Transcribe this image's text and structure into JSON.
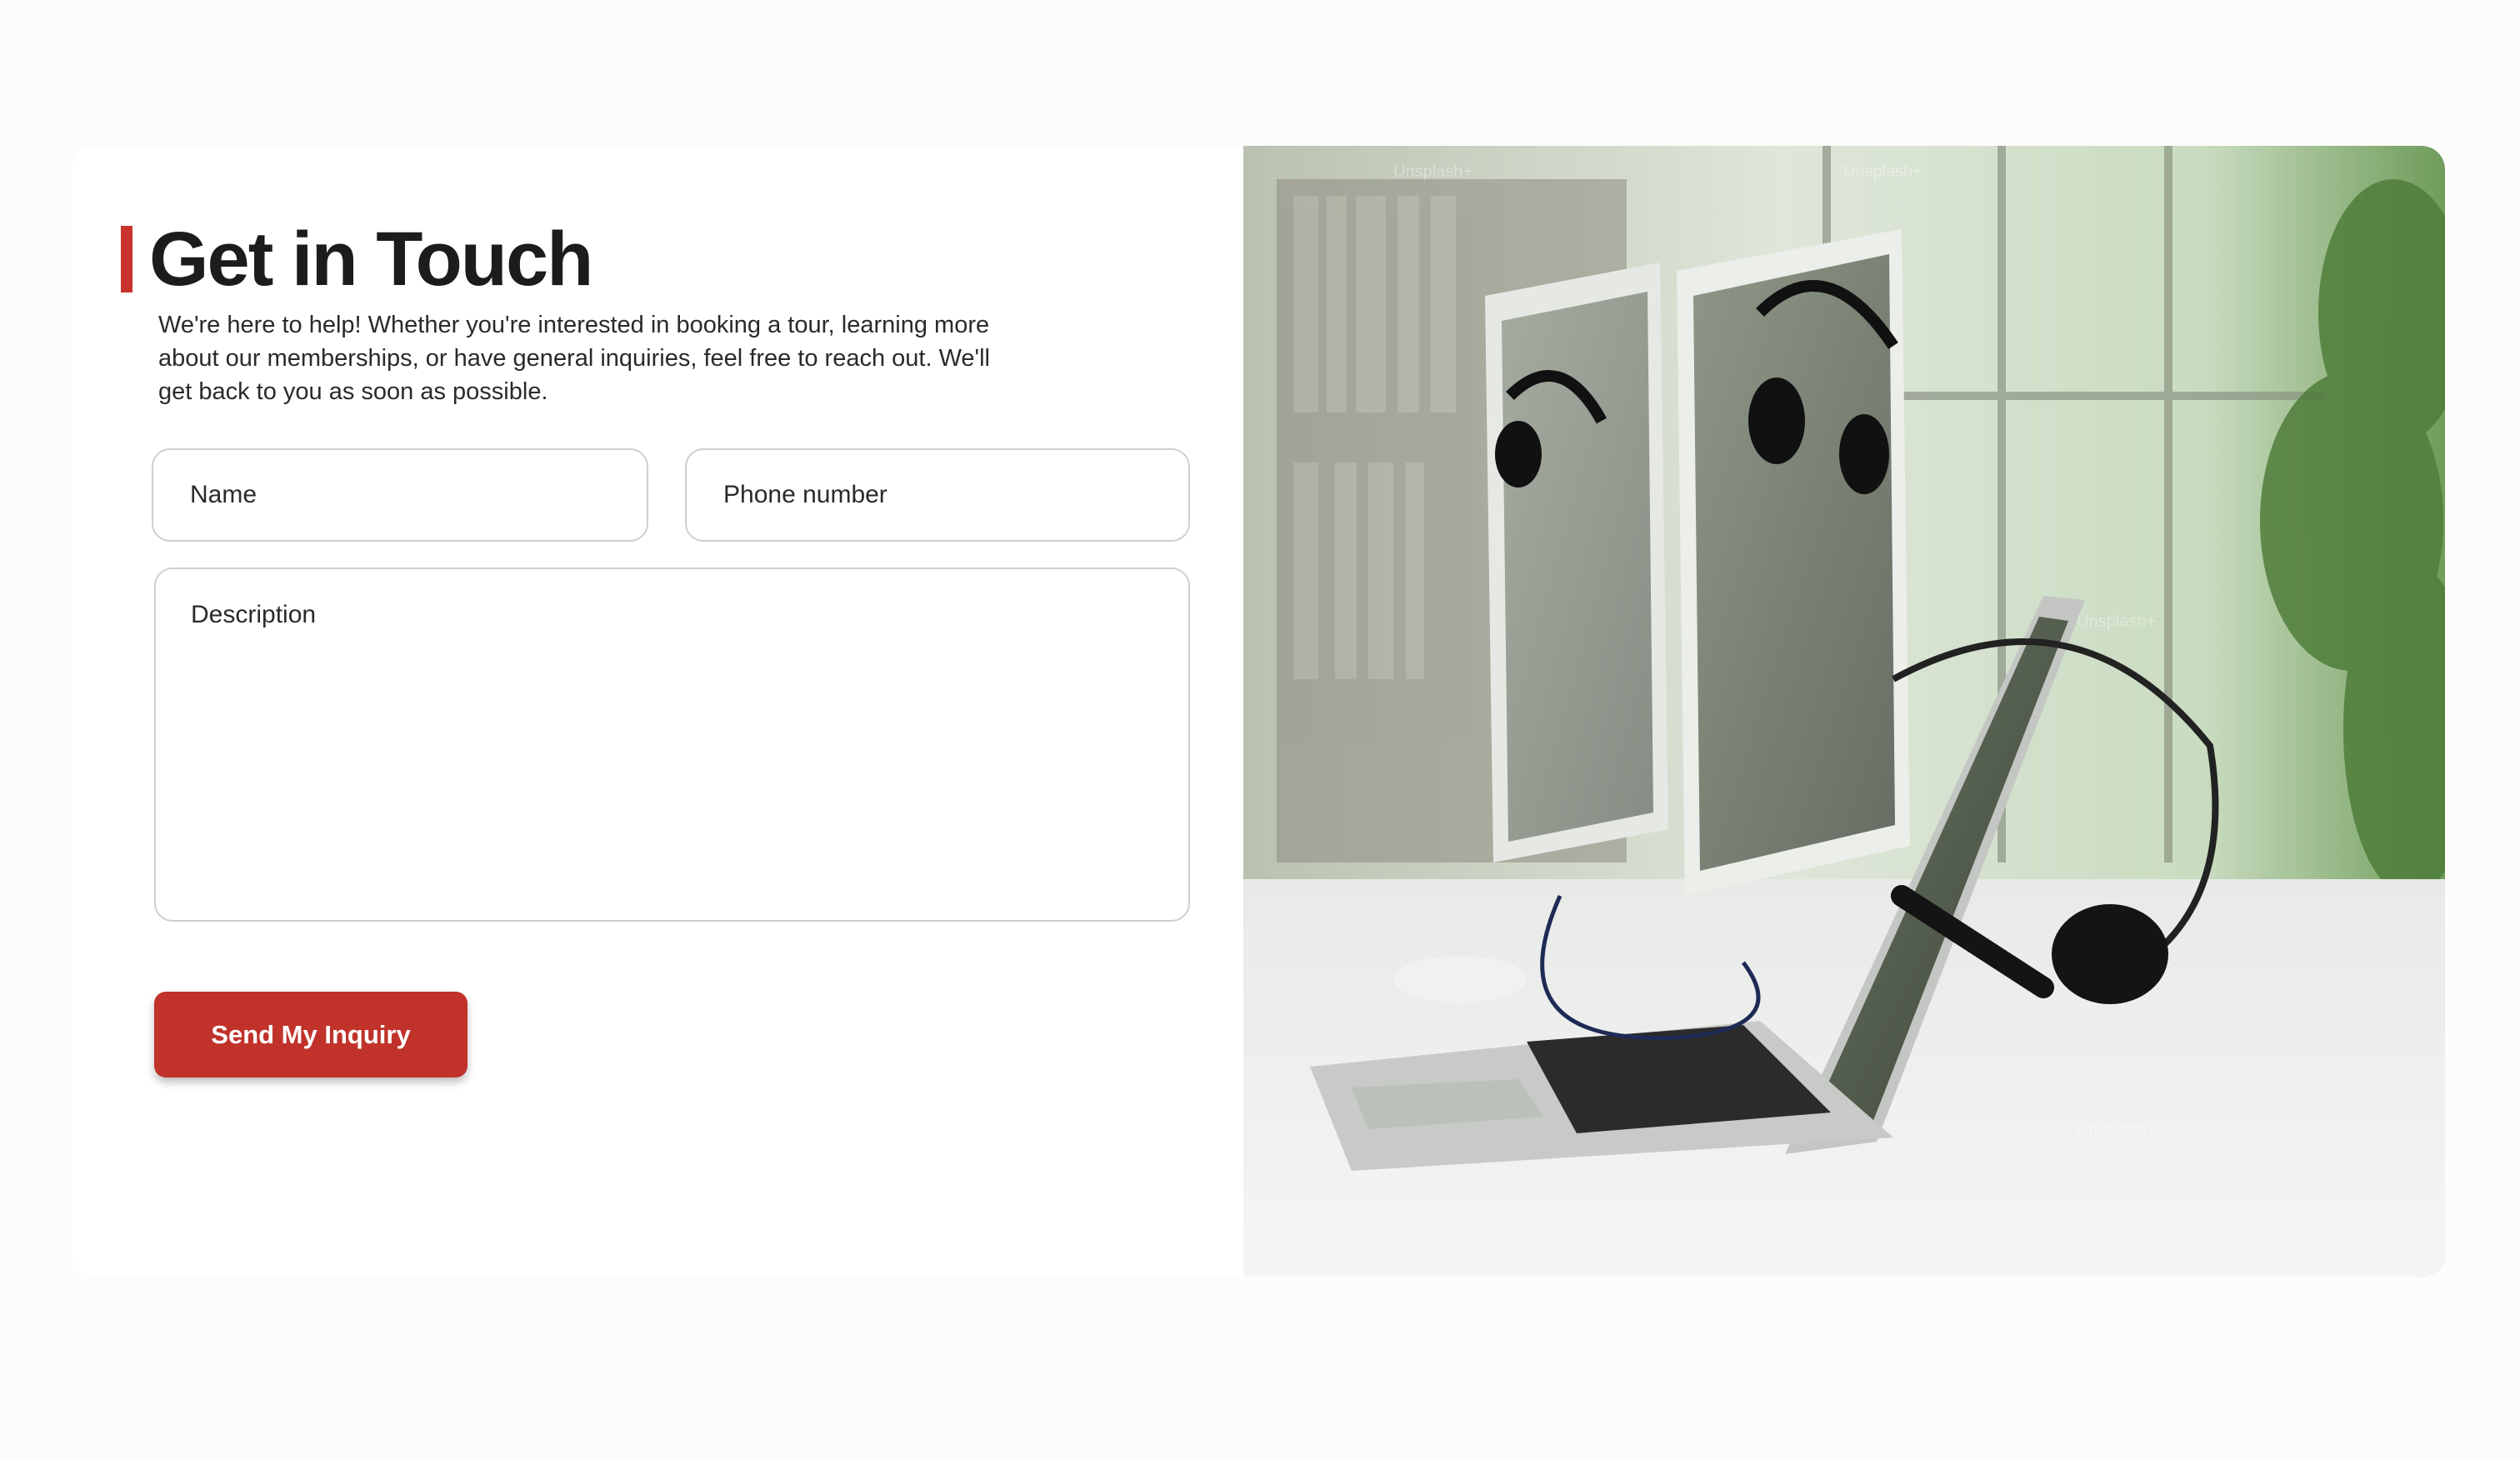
{
  "contact": {
    "title": "Get in Touch",
    "intro": "We're here to help! Whether you're interested in booking a tour, learning more about our memberships, or have general inquiries, feel free to reach out. We'll get back to you as soon as possible.",
    "fields": {
      "name_placeholder": "Name",
      "phone_placeholder": "Phone number",
      "description_placeholder": "Description"
    },
    "submit_label": "Send My Inquiry",
    "accent_color": "#c8342d",
    "button_color": "#c0322a"
  },
  "photo": {
    "watermark": "Unsplash+"
  }
}
